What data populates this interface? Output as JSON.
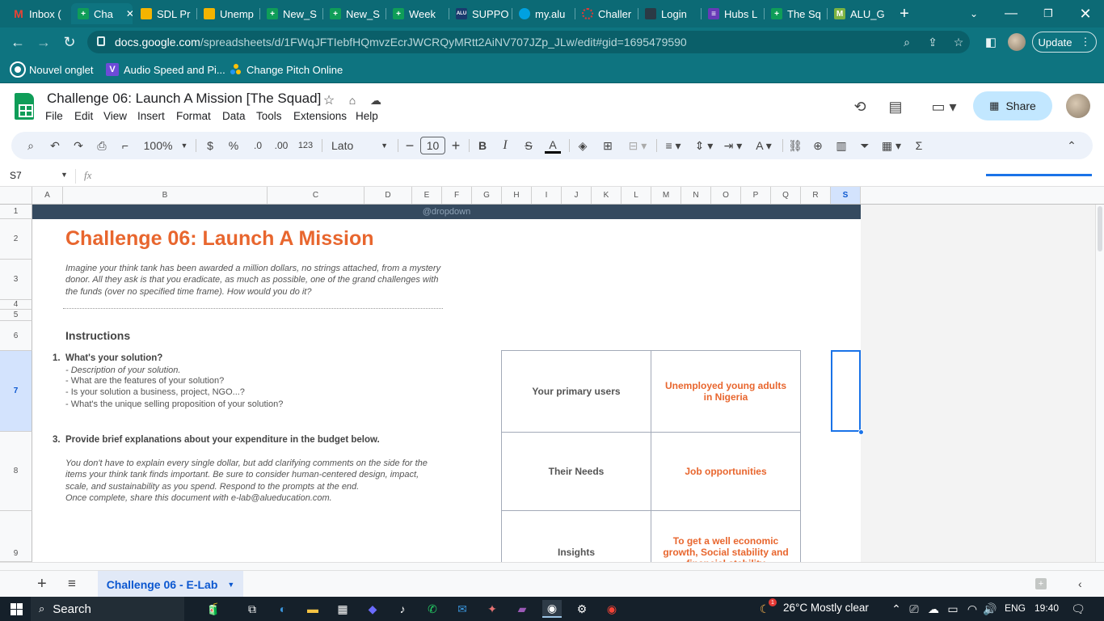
{
  "browser": {
    "tabs": [
      {
        "label": "Inbox (",
        "icon": "gmail-icon",
        "color": "#ea4335"
      },
      {
        "label": "Cha",
        "icon": "sheets-icon",
        "color": "#0f9d58",
        "active": true
      },
      {
        "label": "SDL Pr",
        "icon": "slides-icon",
        "color": "#f4b400"
      },
      {
        "label": "Unemp",
        "icon": "slides-icon",
        "color": "#f4b400"
      },
      {
        "label": "New_S",
        "icon": "sheets-icon",
        "color": "#0f9d58"
      },
      {
        "label": "New_S",
        "icon": "sheets-icon",
        "color": "#0f9d58"
      },
      {
        "label": "Week",
        "icon": "sheets-icon",
        "color": "#0f9d58"
      },
      {
        "label": "SUPPO",
        "icon": "alu-icon",
        "color": "#1a3b6e"
      },
      {
        "label": "my.alu",
        "icon": "salesforce-icon",
        "color": "#00a1e0"
      },
      {
        "label": "Challer",
        "icon": "loading-icon",
        "color": "#e53935"
      },
      {
        "label": "Login",
        "icon": "login-icon",
        "color": "#333"
      },
      {
        "label": "Hubs L",
        "icon": "hubs-icon",
        "color": "#673ab7"
      },
      {
        "label": "The Sq",
        "icon": "sheets-icon",
        "color": "#0f9d58"
      },
      {
        "label": "ALU_G",
        "icon": "alu-g-icon",
        "color": "#7cb342"
      }
    ],
    "tab_close": "✕",
    "new_tab": "+",
    "url_host": "docs.google.com",
    "url_path": "/spreadsheets/d/1FWqJFTIebfHQmvzEcrJWCRQyMRtt2AiNV707JZp_JLw/edit#gid=1695479590",
    "update_label": "Update",
    "bookmarks": [
      {
        "label": "Nouvel onglet",
        "icon": "chrome-icon"
      },
      {
        "label": "Audio Speed and Pi...",
        "icon": "v-icon"
      },
      {
        "label": "Change Pitch Online",
        "icon": "dots-icon"
      }
    ]
  },
  "sheets": {
    "title": "Challenge 06: Launch A Mission [The Squad]",
    "menu": [
      "File",
      "Edit",
      "View",
      "Insert",
      "Format",
      "Data",
      "Tools",
      "Extensions",
      "Help"
    ],
    "share_label": "Share",
    "toolbar": {
      "zoom": "100%",
      "currency": "$",
      "percent": "%",
      "dec_decrease": ".0",
      "dec_increase": ".00",
      "format_123": "123",
      "font": "Lato",
      "font_size": "10"
    },
    "name_box": "S7",
    "fx": "fx",
    "columns": [
      "A",
      "B",
      "C",
      "D",
      "E",
      "F",
      "G",
      "H",
      "I",
      "J",
      "K",
      "L",
      "M",
      "N",
      "O",
      "P",
      "Q",
      "R",
      "S"
    ],
    "rows": [
      "1",
      "2",
      "3",
      "4",
      "5",
      "6",
      "7",
      "8",
      "9"
    ],
    "cells": {
      "dropdown": "@dropdown",
      "heading": "Challenge 06: Launch A Mission",
      "intro": "Imagine your think tank has been awarded a million dollars, no strings attached, from a mystery donor. All they ask is that you eradicate, as much as possible, one of the grand challenges with the funds (over no specified time frame). How would you do it?",
      "instructions": "Instructions",
      "q1_num": "1.",
      "q1_title": "What's your solution?",
      "q1_lines": [
        "- Description of your solution.",
        "- What are the features of your solution?",
        "- Is your solution a business, project, NGO...?",
        "- What's the unique selling proposition of your solution?"
      ],
      "q3_num": "3.",
      "q3_title": "Provide brief explanations about your expenditure in the budget below.",
      "q3_body": "You don't have to explain every single dollar, but add clarifying comments on the side for the items your think tank finds important. Be sure to consider human-centered design, impact, scale, and sustainability as you spend. Respond to the prompts at the end.",
      "q3_share": "Once complete, share this document with e-lab@alueducation.com.",
      "table": [
        {
          "label": "Your primary users",
          "value": "Unemployed young adults in Nigeria"
        },
        {
          "label": "Their Needs",
          "value": "Job opportunities"
        },
        {
          "label": "Insights",
          "value": "To get a well economic growth, Social stability and financial stability"
        }
      ]
    },
    "sheet_tab": "Challenge 06 - E-Lab"
  },
  "taskbar": {
    "search": "Search",
    "weather": "26°C  Mostly clear",
    "lang": "ENG",
    "time": "19:40",
    "notif_badge": "1"
  },
  "colors": {
    "accent_orange": "#e8662e",
    "teal": "#0e7480",
    "band": "#354a5f",
    "selection_blue": "#1a73e8"
  }
}
